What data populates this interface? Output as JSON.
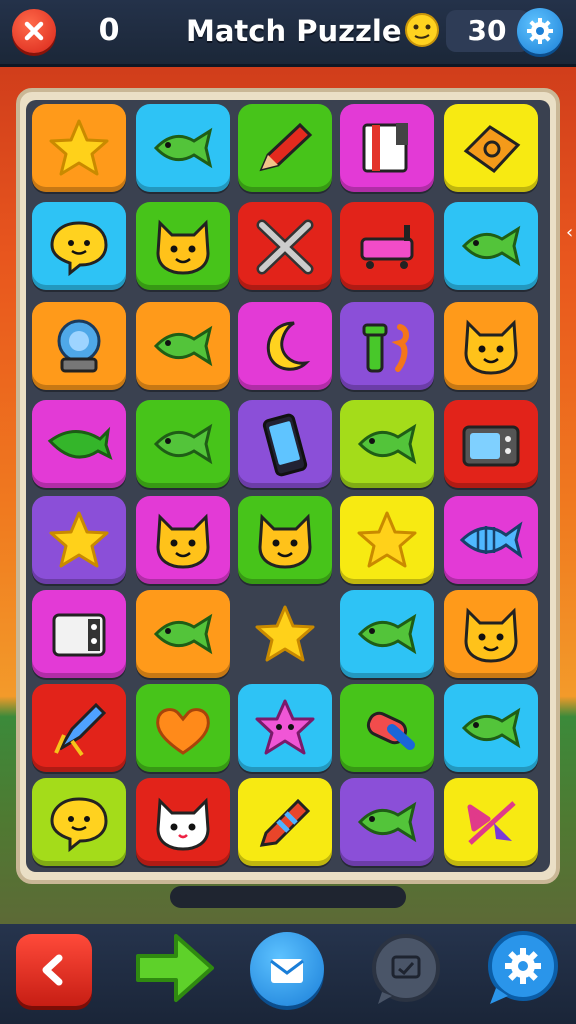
{
  "header": {
    "score": "0",
    "title": "Match Puzzle",
    "moves": "30"
  },
  "colors": {
    "orange": "#ff9a1a",
    "blue": "#2ec3f5",
    "green": "#47c41a",
    "magenta": "#e33ad6",
    "yellow": "#f7ea12",
    "red": "#e2231a",
    "purple": "#8b4fd8",
    "lime": "#a4dc1a"
  },
  "board": {
    "rows": [
      [
        {
          "color": "orange",
          "icon": "star-icon"
        },
        {
          "color": "blue",
          "icon": "fish-icon"
        },
        {
          "color": "green",
          "icon": "pencil-icon"
        },
        {
          "color": "magenta",
          "icon": "book-icon"
        },
        {
          "color": "yellow",
          "icon": "ticket-icon"
        }
      ],
      [
        {
          "color": "blue",
          "icon": "chat-bubble-face-icon"
        },
        {
          "color": "green",
          "icon": "cat-face-icon"
        },
        {
          "color": "red",
          "icon": "crossed-swords-icon"
        },
        {
          "color": "red",
          "icon": "bathtub-icon"
        },
        {
          "color": "blue",
          "icon": "fish-icon"
        }
      ],
      [
        {
          "color": "orange",
          "icon": "diving-helmet-icon"
        },
        {
          "color": "orange",
          "icon": "fish-icon"
        },
        {
          "color": "magenta",
          "icon": "moon-icon"
        },
        {
          "color": "purple",
          "icon": "tube-seahorse-icon"
        },
        {
          "color": "orange",
          "icon": "cat-face-icon"
        }
      ],
      [
        {
          "color": "magenta",
          "icon": "leaf-fish-icon"
        },
        {
          "color": "green",
          "icon": "fish-icon"
        },
        {
          "color": "purple",
          "icon": "phone-icon"
        },
        {
          "color": "lime",
          "icon": "fish-icon"
        },
        {
          "color": "red",
          "icon": "tv-icon"
        }
      ],
      [
        {
          "color": "purple",
          "icon": "star-icon"
        },
        {
          "color": "magenta",
          "icon": "cat-face-icon"
        },
        {
          "color": "green",
          "icon": "cat-face-icon"
        },
        {
          "color": "yellow",
          "icon": "star-icon"
        },
        {
          "color": "magenta",
          "icon": "striped-fish-icon"
        }
      ],
      [
        {
          "color": "magenta",
          "icon": "camera-icon"
        },
        {
          "color": "orange",
          "icon": "fish-icon"
        },
        {
          "color": "empty",
          "icon": "star-icon"
        },
        {
          "color": "blue",
          "icon": "fish-icon"
        },
        {
          "color": "orange",
          "icon": "cat-face-icon"
        }
      ],
      [
        {
          "color": "red",
          "icon": "rocket-icon"
        },
        {
          "color": "green",
          "icon": "heart-icon"
        },
        {
          "color": "blue",
          "icon": "starfish-face-icon"
        },
        {
          "color": "green",
          "icon": "candy-icon"
        },
        {
          "color": "blue",
          "icon": "fish-icon"
        }
      ],
      [
        {
          "color": "lime",
          "icon": "chat-bubble-face-icon"
        },
        {
          "color": "red",
          "icon": "white-cat-icon"
        },
        {
          "color": "yellow",
          "icon": "crayon-icon"
        },
        {
          "color": "purple",
          "icon": "fish-icon"
        },
        {
          "color": "yellow",
          "icon": "bow-icon"
        }
      ]
    ]
  },
  "bottom_bar": {
    "buttons": [
      "back-arrow-icon",
      "next-arrow-icon",
      "mail-icon",
      "chat-icon",
      "gear-icon"
    ]
  }
}
